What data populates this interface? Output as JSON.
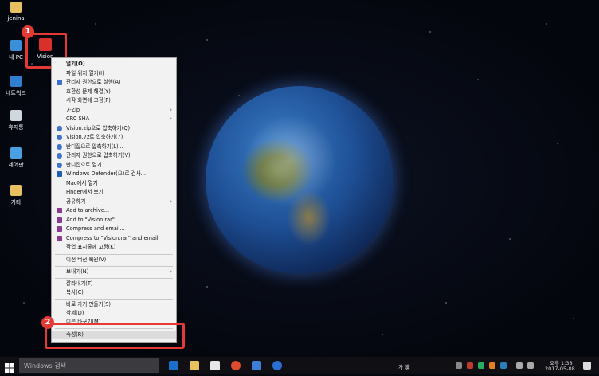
{
  "desktop": {
    "icons": [
      {
        "label": "jenina"
      },
      {
        "label": "내 PC"
      },
      {
        "label": "Vision"
      },
      {
        "label": "네트워크"
      },
      {
        "label": "휴지통"
      },
      {
        "label": "제어판"
      },
      {
        "label": "기타"
      }
    ],
    "badges": [
      "1",
      "2"
    ]
  },
  "context_menu": {
    "items": [
      {
        "label": "열기(O)"
      },
      {
        "label": "파일 위치 열기(I)"
      },
      {
        "label": "관리자 권한으로 실행(A)"
      },
      {
        "label": "호환성 문제 해결(Y)"
      },
      {
        "label": "시작 화면에 고정(P)"
      },
      {
        "label": "7-Zip"
      },
      {
        "label": "CRC SHA"
      },
      {
        "label": "Vision.zip으로 압축하기(Q)"
      },
      {
        "label": "Vision.7z로 압축하기(7)"
      },
      {
        "label": "반디집으로 압축하기(L)..."
      },
      {
        "label": "관리자 권한으로 압축하기(V)"
      },
      {
        "label": "반디집으로 열기"
      },
      {
        "label": "Windows Defender(으)로 검사..."
      },
      {
        "label": "Mac에서 열기"
      },
      {
        "label": "Finder에서 보기"
      },
      {
        "label": "공유하기"
      },
      {
        "label": "Add to archive..."
      },
      {
        "label": "Add to \"Vision.rar\""
      },
      {
        "label": "Compress and email..."
      },
      {
        "label": "Compress to \"Vision.rar\" and email"
      },
      {
        "label": "작업 표시줄에 고정(K)"
      },
      {
        "label": "이전 버전 복원(V)"
      },
      {
        "label": "보내기(N)"
      },
      {
        "label": "잘라내기(T)"
      },
      {
        "label": "복사(C)"
      },
      {
        "label": "바로 가기 만들기(S)"
      },
      {
        "label": "삭제(D)"
      },
      {
        "label": "이름 바꾸기(M)"
      },
      {
        "label": "속성(R)"
      }
    ]
  },
  "taskbar": {
    "search_placeholder": "Windows 검색",
    "ime": "가 漢",
    "time": "오후 1:38",
    "date": "2017-05-08"
  },
  "colors": {
    "highlight": "#e53935",
    "menu_bg": "#f2f2f2",
    "taskbar": "#101014"
  }
}
